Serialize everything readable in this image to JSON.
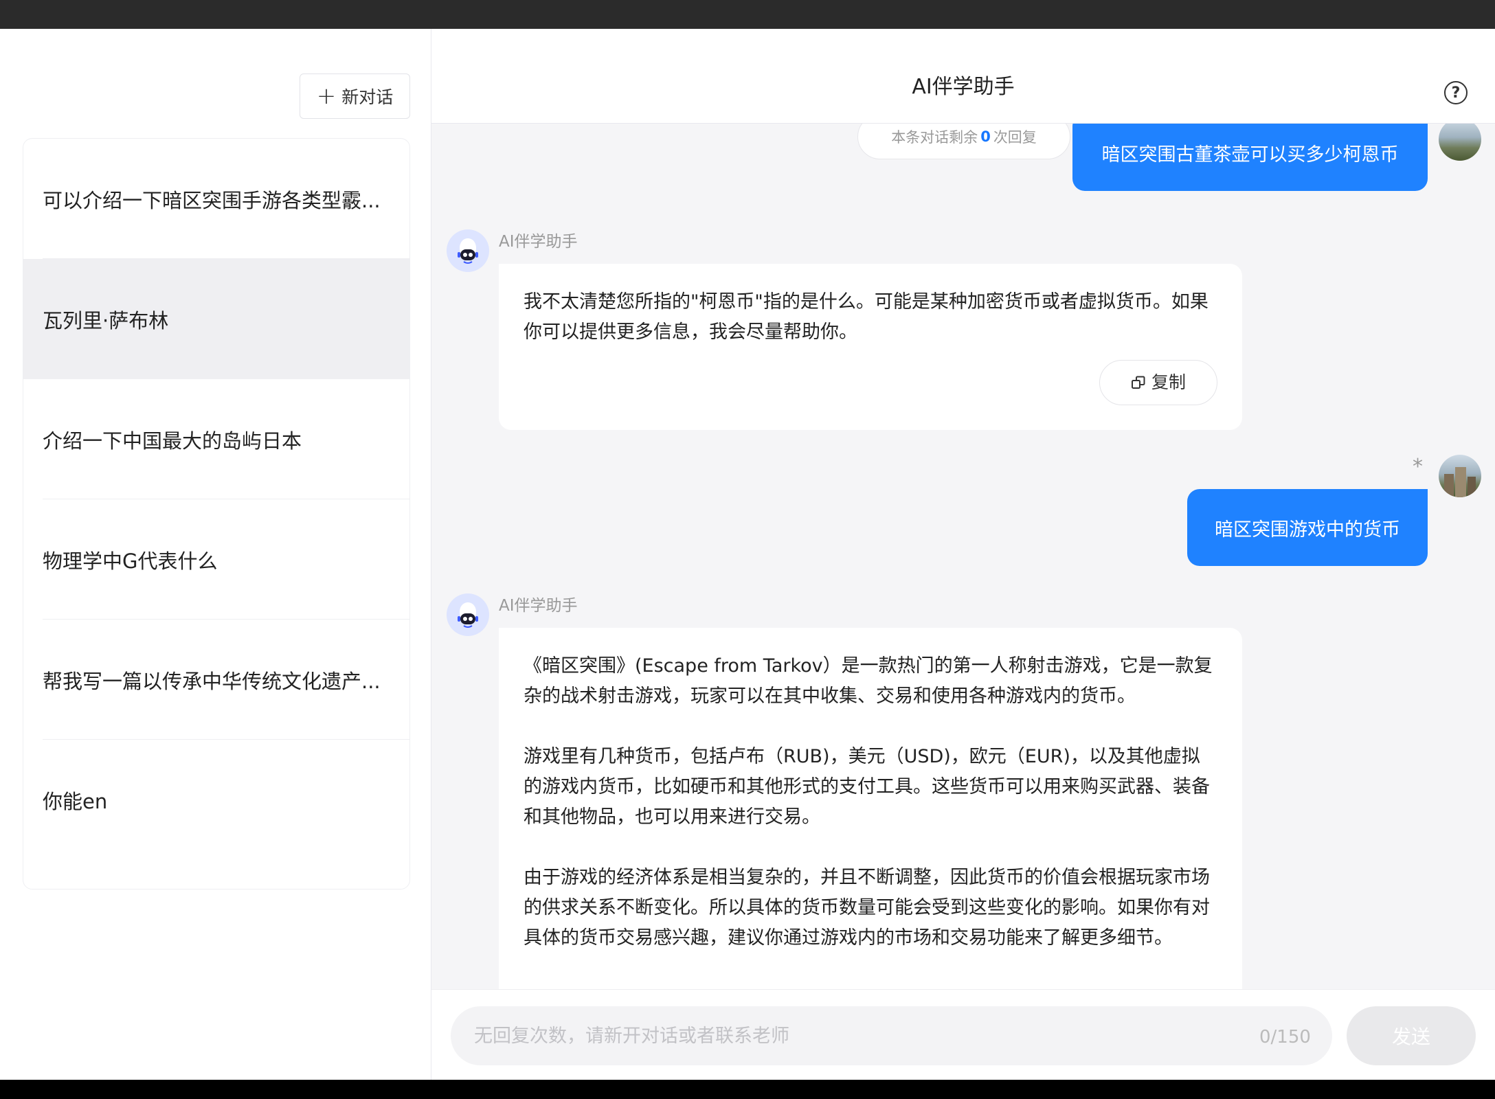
{
  "sidebar": {
    "new_chat_label": "新对话",
    "conversations": [
      {
        "title": "可以介绍一下暗区突围手游各类型霰..."
      },
      {
        "title": "瓦列里·萨布林"
      },
      {
        "title": "介绍一下中国最大的岛屿日本"
      },
      {
        "title": "物理学中G代表什么"
      },
      {
        "title": "帮我写一篇以传承中华传统文化遗产..."
      },
      {
        "title": "你能en"
      }
    ],
    "active_index": 1
  },
  "header": {
    "title": "AI伴学助手",
    "help_icon": "question-circle-icon"
  },
  "chat": {
    "remaining": {
      "prefix": "本条对话剩余",
      "count": "0",
      "suffix": "次回复"
    },
    "messages": [
      {
        "role": "user",
        "text": "暗区突围古董茶壶可以买多少柯恩币"
      },
      {
        "role": "bot",
        "name": "AI伴学助手",
        "paragraphs": [
          "我不太清楚您所指的\"柯恩币\"指的是什么。可能是某种加密货币或者虚拟货币。如果你可以提供更多信息，我会尽量帮助你。"
        ],
        "copy_label": "复制"
      },
      {
        "role": "user",
        "text": "暗区突围游戏中的货币",
        "marker": "*"
      },
      {
        "role": "bot",
        "name": "AI伴学助手",
        "paragraphs": [
          "《暗区突围》(Escape from Tarkov）是一款热门的第一人称射击游戏，它是一款复杂的战术射击游戏，玩家可以在其中收集、交易和使用各种游戏内的货币。",
          "游戏里有几种货币，包括卢布（RUB)，美元（USD)，欧元（EUR)，以及其他虚拟的游戏内货币，比如硬币和其他形式的支付工具。这些货币可以用来购买武器、装备和其他物品，也可以用来进行交易。",
          "由于游戏的经济体系是相当复杂的，并且不断调整，因此货币的价值会根据玩家市场的供求关系不断变化。所以具体的货币数量可能会受到这些变化的影响。如果你有对具体的货币交易感兴趣，建议你通过游戏内的市场和交易功能来了解更多细节。"
        ]
      }
    ]
  },
  "input": {
    "placeholder": "无回复次数，请新开对话或者联系老师",
    "char_count": "0/150",
    "send_label": "发送"
  },
  "colors": {
    "accent": "#1f82ff",
    "active_item_bg": "#efeff2",
    "chat_bg": "#f5f5f7",
    "bot_avatar_bg": "#dde4ff"
  }
}
